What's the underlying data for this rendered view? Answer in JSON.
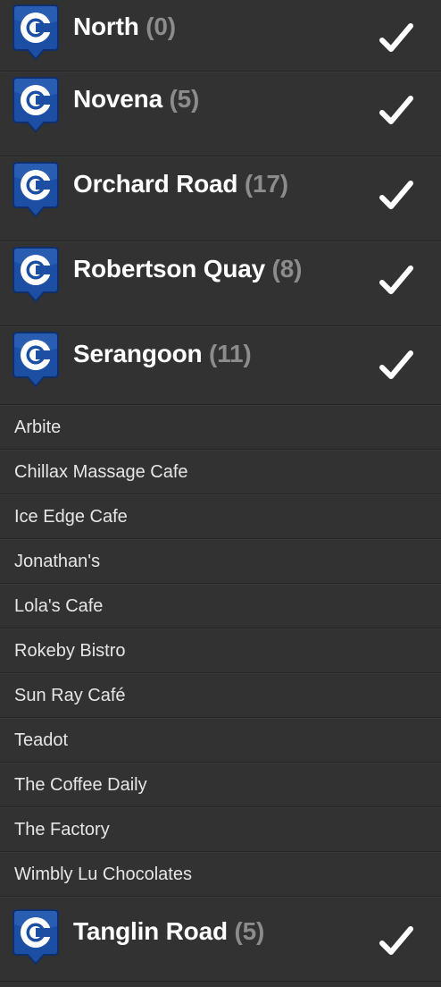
{
  "regions_top": [
    {
      "name": "North",
      "count": "(0)",
      "checked": true
    },
    {
      "name": "Novena",
      "count": "(5)",
      "checked": true
    },
    {
      "name": "Orchard Road",
      "count": "(17)",
      "checked": true
    },
    {
      "name": "Robertson Quay",
      "count": "(8)",
      "checked": true
    },
    {
      "name": "Serangoon",
      "count": "(11)",
      "checked": true
    }
  ],
  "serangoon_items": [
    "Arbite",
    "Chillax Massage Cafe",
    "Ice Edge Cafe",
    "Jonathan's",
    "Lola's Cafe",
    "Rokeby Bistro",
    "Sun Ray Café",
    "Teadot",
    "The Coffee Daily",
    "The Factory",
    "Wimbly Lu Chocolates"
  ],
  "regions_bottom": [
    {
      "name": "Tanglin Road",
      "count": "(5)",
      "checked": true
    }
  ],
  "colors": {
    "pin_blue": "#1c4fa3",
    "pin_border": "#0e2f6b",
    "background": "#323232",
    "count_gray": "#8c8c8c"
  },
  "icons": {
    "region_pin": "map-pin-c-icon",
    "checked": "checkmark-icon"
  }
}
